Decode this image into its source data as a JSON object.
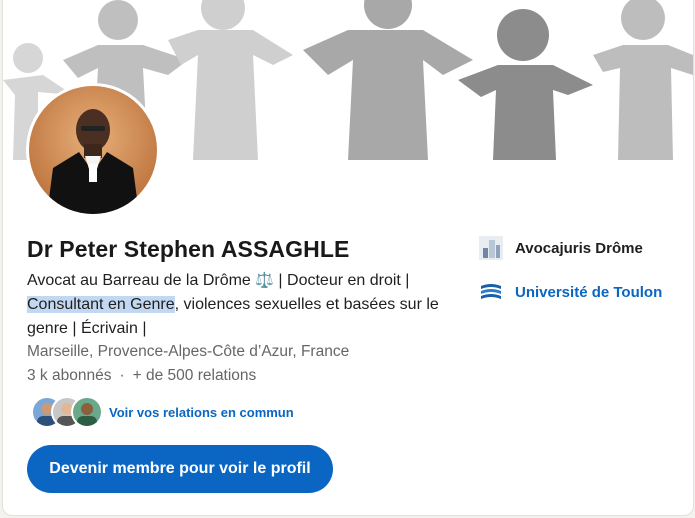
{
  "profile": {
    "name": "Dr Peter Stephen ASSAGHLE",
    "headline_part1": "Avocat au Barreau de la Drôme ",
    "headline_emoji": "⚖️",
    "headline_part2": " | Docteur en droit | ",
    "headline_highlight": "Consultant en Genre",
    "headline_part3": ", violences sexuelles et basées sur le genre | Écrivain |",
    "location": "Marseille, Provence-Alpes-Côte d’Azur, France",
    "followers": "3 k abonnés",
    "separator": "·",
    "connections": "+ de 500 relations"
  },
  "mutual": {
    "link_label": "Voir vos relations en commun"
  },
  "cta": {
    "join_label": "Devenir membre pour voir le profil"
  },
  "orgs": [
    {
      "name": "Avocajuris Drôme",
      "icon": "company-logo-icon"
    },
    {
      "name": "Université de Toulon",
      "icon": "university-logo-icon"
    }
  ],
  "colors": {
    "accent": "#0a66c2",
    "highlight": "#c2d8f2",
    "muted_text": "#666666"
  }
}
